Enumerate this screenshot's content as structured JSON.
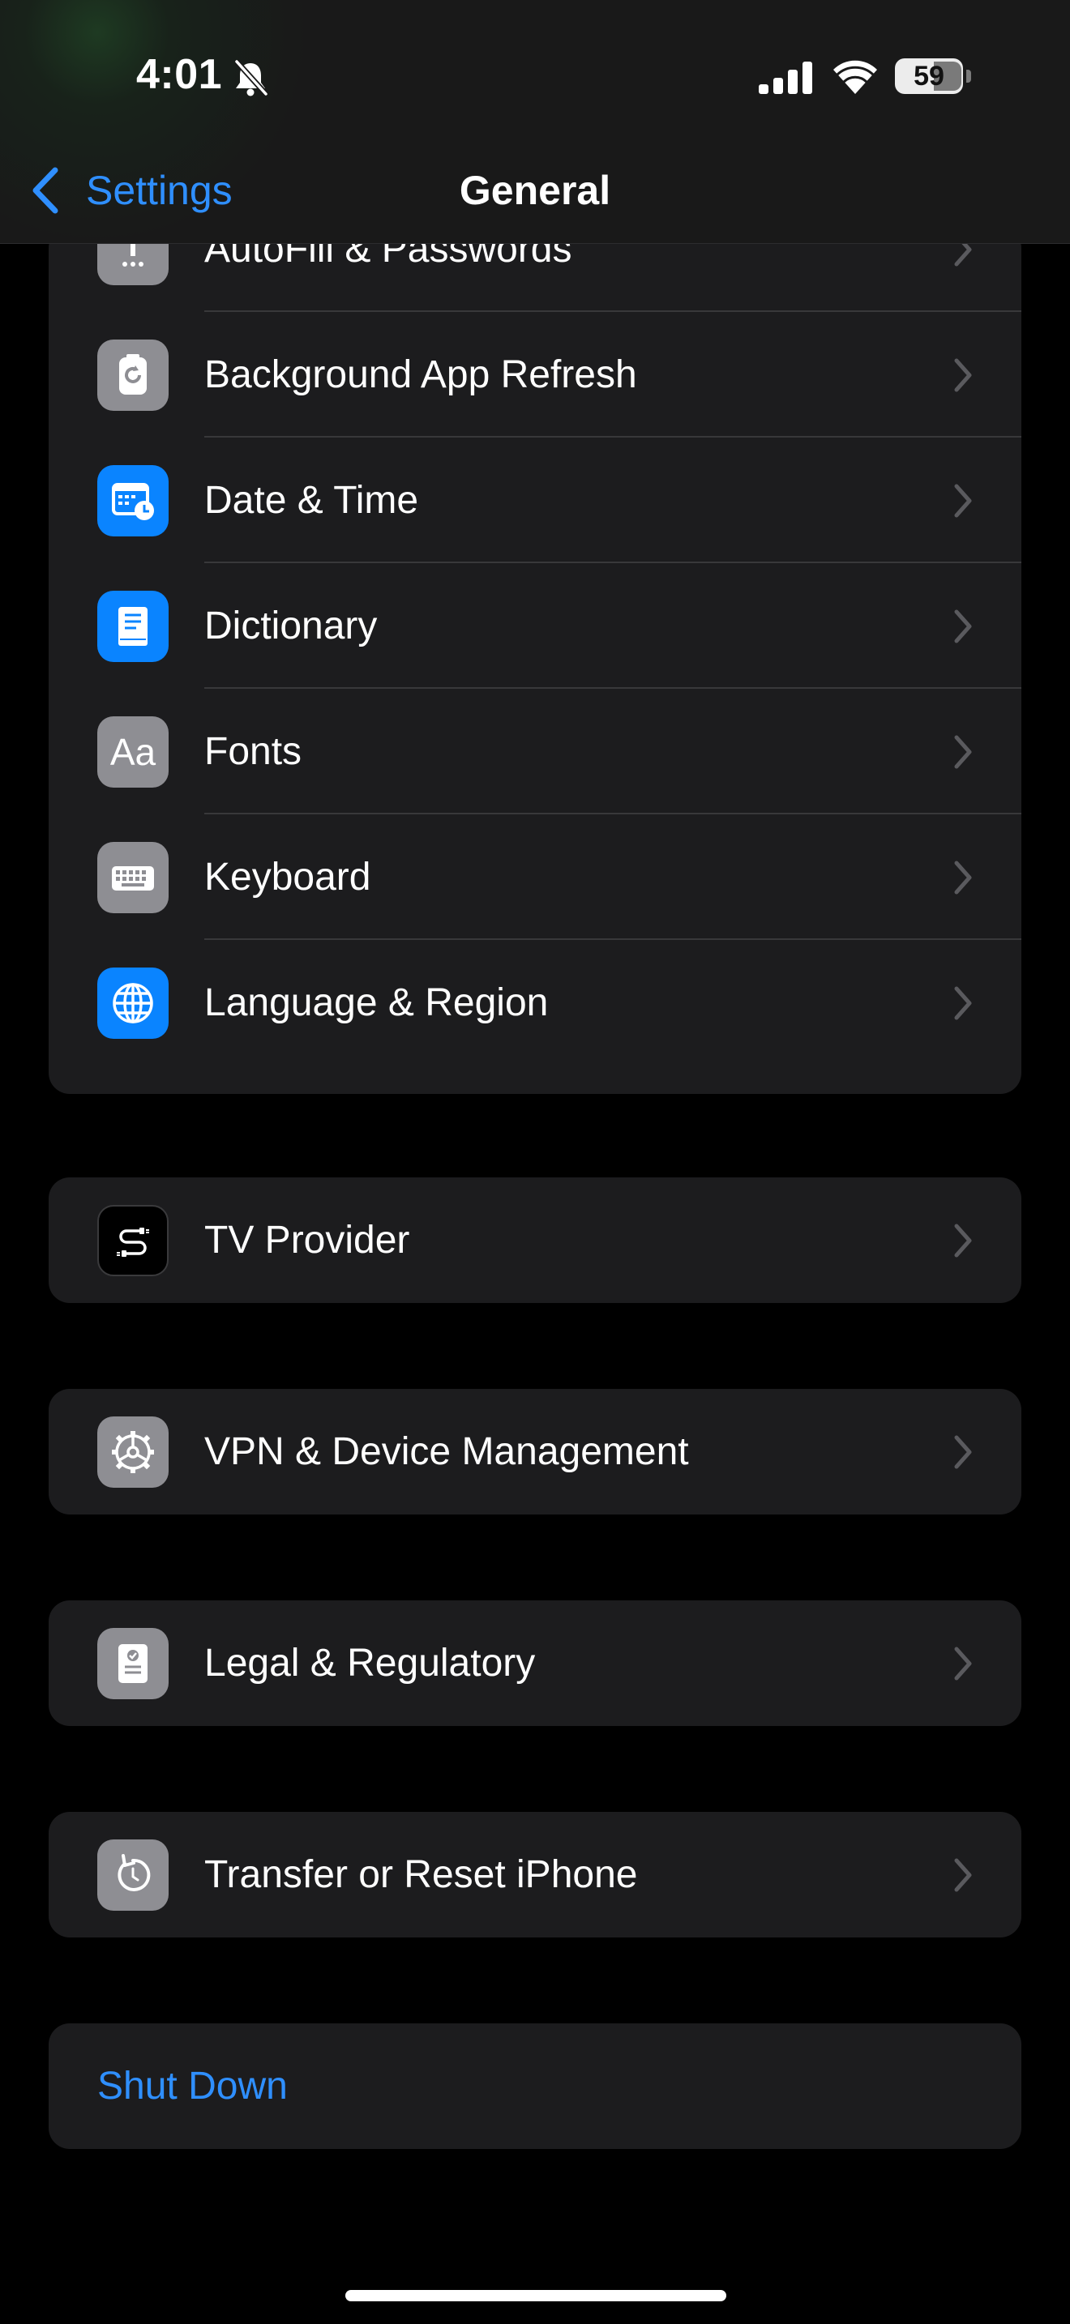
{
  "status_bar": {
    "time": "4:01",
    "battery": "59",
    "icons": [
      "bell-slash-icon",
      "cellular-signal-icon",
      "wifi-icon",
      "battery-icon"
    ]
  },
  "nav": {
    "back_label": "Settings",
    "title": "General"
  },
  "groups": [
    {
      "items": [
        {
          "label": "AutoFill & Passwords",
          "icon": "key-icon",
          "icon_color": "#8e8e93"
        },
        {
          "label": "Background App Refresh",
          "icon": "app-refresh-icon",
          "icon_color": "#8e8e93"
        },
        {
          "label": "Date & Time",
          "icon": "calendar-clock-icon",
          "icon_color": "#0a84ff"
        },
        {
          "label": "Dictionary",
          "icon": "book-icon",
          "icon_color": "#0a84ff"
        },
        {
          "label": "Fonts",
          "icon": "fonts-icon",
          "icon_glyph": "Aa",
          "icon_color": "#8e8e93"
        },
        {
          "label": "Keyboard",
          "icon": "keyboard-icon",
          "icon_color": "#8e8e93"
        },
        {
          "label": "Language & Region",
          "icon": "globe-icon",
          "icon_color": "#0a84ff"
        }
      ]
    },
    {
      "items": [
        {
          "label": "TV Provider",
          "icon": "tv-provider-icon",
          "icon_color": "#000000"
        }
      ]
    },
    {
      "items": [
        {
          "label": "VPN & Device Management",
          "icon": "gear-icon",
          "icon_color": "#8e8e93"
        }
      ]
    },
    {
      "items": [
        {
          "label": "Legal & Regulatory",
          "icon": "certificate-icon",
          "icon_color": "#8e8e93"
        }
      ]
    },
    {
      "items": [
        {
          "label": "Transfer or Reset iPhone",
          "icon": "reset-icon",
          "icon_color": "#8e8e93"
        }
      ]
    }
  ],
  "shut_down": {
    "label": "Shut Down"
  },
  "colors": {
    "accent": "#0a84ff",
    "cell_background": "#1c1c1e",
    "separator": "#38383a",
    "page_background": "#000000"
  }
}
